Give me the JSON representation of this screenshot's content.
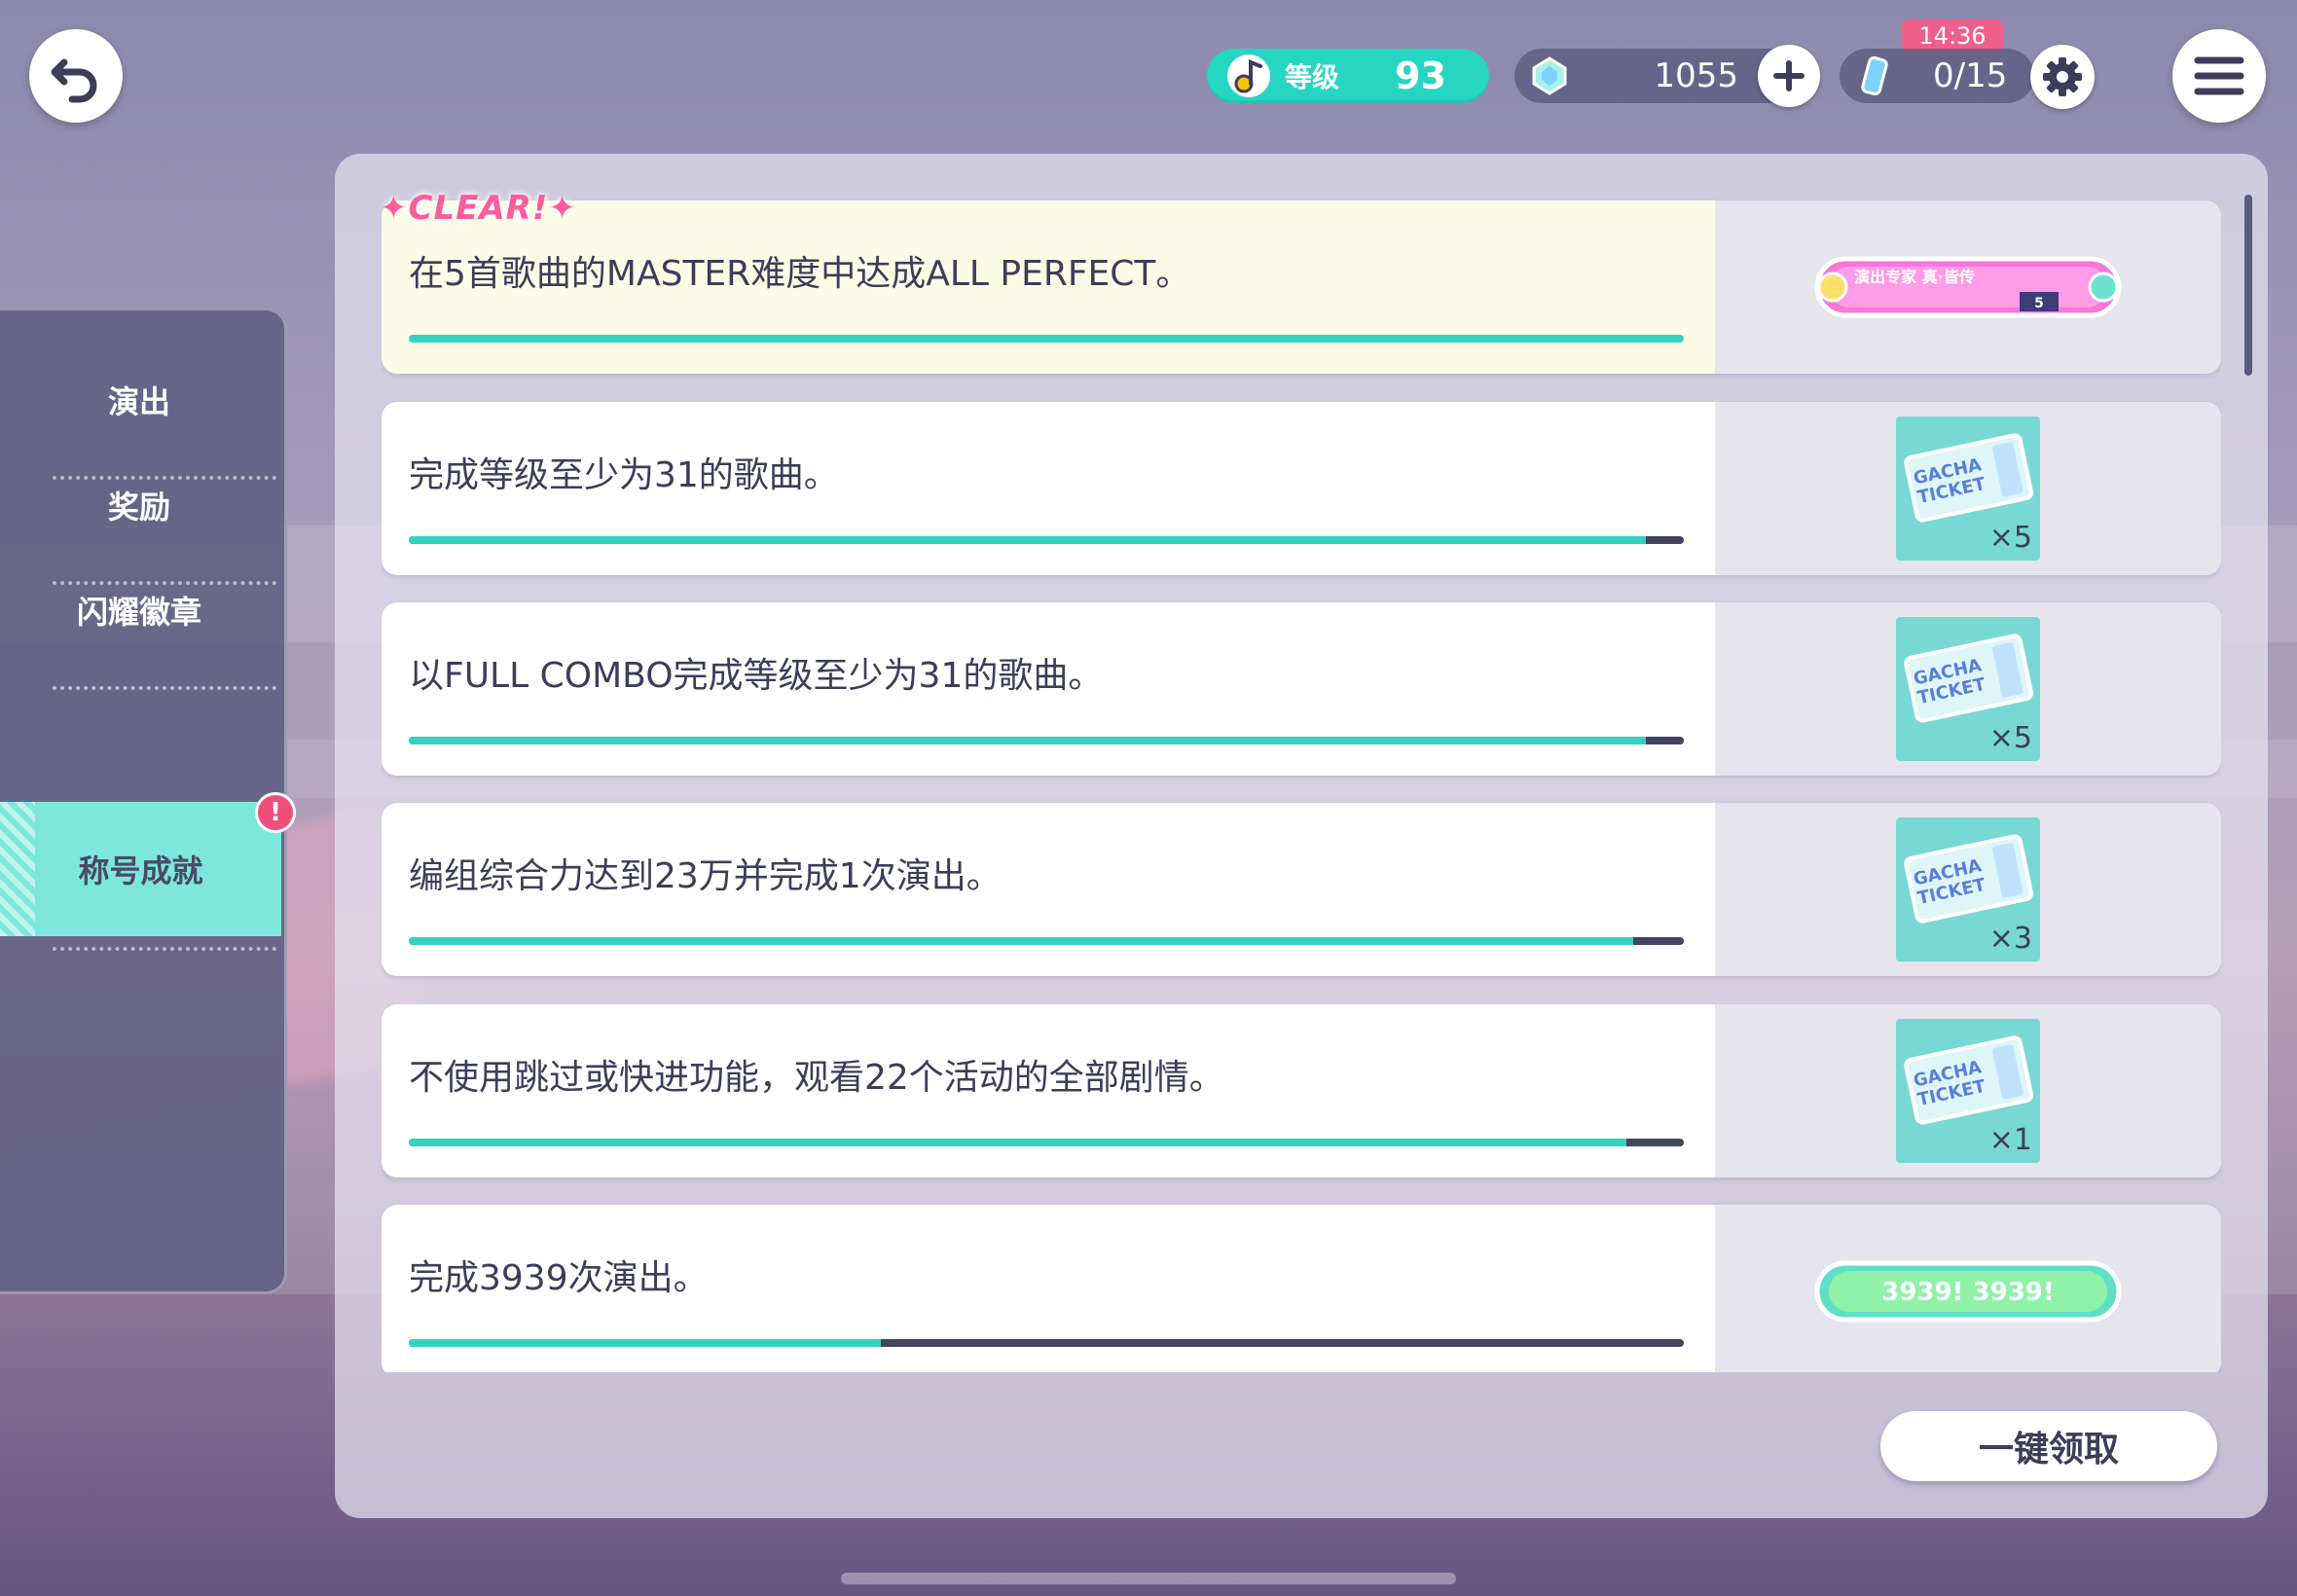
{
  "header": {
    "level_label": "等级",
    "level_value": "93",
    "gems": "1055",
    "time": "14:36",
    "tickets": "0/15"
  },
  "sidebar": {
    "items": [
      {
        "label": "演出"
      },
      {
        "label": "奖励"
      },
      {
        "label": "闪耀徽章"
      },
      {
        "label": "称号成就"
      }
    ],
    "active_index": 3,
    "alert_mark": "!"
  },
  "clear_label": "✦CLEAR!✦",
  "missions": [
    {
      "desc": "在5首歌曲的MASTER难度中达成ALL PERFECT。",
      "progress": 1.0,
      "cleared": true,
      "reward_type": "title-badge",
      "reward_text": "演出专家 真·皆传",
      "reward_badge_number": "5"
    },
    {
      "desc": "完成等级至少为31的歌曲。",
      "progress": 0.97,
      "reward_type": "gacha-ticket",
      "qty": "×5"
    },
    {
      "desc": "以FULL COMBO完成等级至少为31的歌曲。",
      "progress": 0.97,
      "reward_type": "gacha-ticket",
      "qty": "×5"
    },
    {
      "desc": "编组综合力达到23万并完成1次演出。",
      "progress": 0.96,
      "reward_type": "gacha-ticket",
      "qty": "×3"
    },
    {
      "desc": "不使用跳过或快进功能，观看22个活动的全部剧情。",
      "progress": 0.955,
      "reward_type": "gacha-ticket",
      "qty": "×1"
    },
    {
      "desc": "完成3939次演出。",
      "progress": 0.37,
      "reward_type": "title-badge",
      "reward_text": "3939! 3939!"
    }
  ],
  "ticket_art_text": [
    "GACHA",
    "TICKET"
  ],
  "claim_all_label": "一键领取",
  "colors": {
    "accent": "#33d3c1",
    "alert": "#ef4f7b",
    "clear": "#ff5c9c"
  }
}
